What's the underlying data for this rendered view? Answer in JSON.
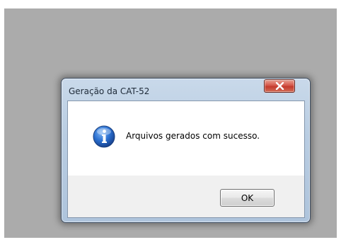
{
  "dialog": {
    "title": "Geração da CAT-52",
    "message": "Arquivos gerados com sucesso.",
    "ok_label": "OK",
    "icon": "information-icon",
    "close_icon": "close-icon"
  },
  "colors": {
    "backdrop": "#ababab",
    "close_button": "#c9473a",
    "info_icon": "#1f63c8",
    "footer": "#f0f0f0"
  }
}
